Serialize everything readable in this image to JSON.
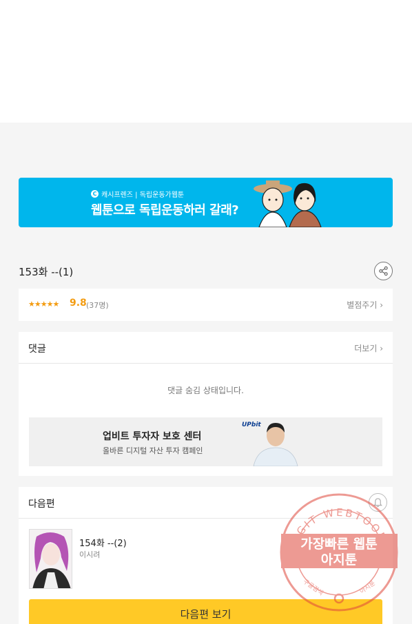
{
  "banner": {
    "brand_label": "캐시프렌즈 | 독립운동가웹툰",
    "headline": "웹툰으로 독립운동하러 갈래?"
  },
  "episode": {
    "title": "153화 --(1)"
  },
  "rating": {
    "stars": "★★★★★",
    "score": "9.8",
    "count": "(37명)",
    "rate_link": "별점주기 ›"
  },
  "comments": {
    "label": "댓글",
    "more": "더보기 ›",
    "hidden_message": "댓글 숨김 상태입니다."
  },
  "ad": {
    "title": "업비트 투자자 보호 센터",
    "subtitle": "올바른 디지털 자산 투자 캠페인",
    "logo": "UPbit"
  },
  "next": {
    "label": "다음편",
    "title": "154화 --(2)",
    "author": "이시려",
    "button_label": "다음편 보기"
  },
  "watermark": {
    "ring_text": "AGIT WEBTOON",
    "line1": "가장빠른 웹툰",
    "line2": "아지툰",
    "bottom_left": "구글검색",
    "bottom_right": "아지툰"
  },
  "colors": {
    "banner": "#00b6ec",
    "accent_star": "#f39c12",
    "next_button": "#ffc926",
    "watermark": "#e0483c"
  }
}
